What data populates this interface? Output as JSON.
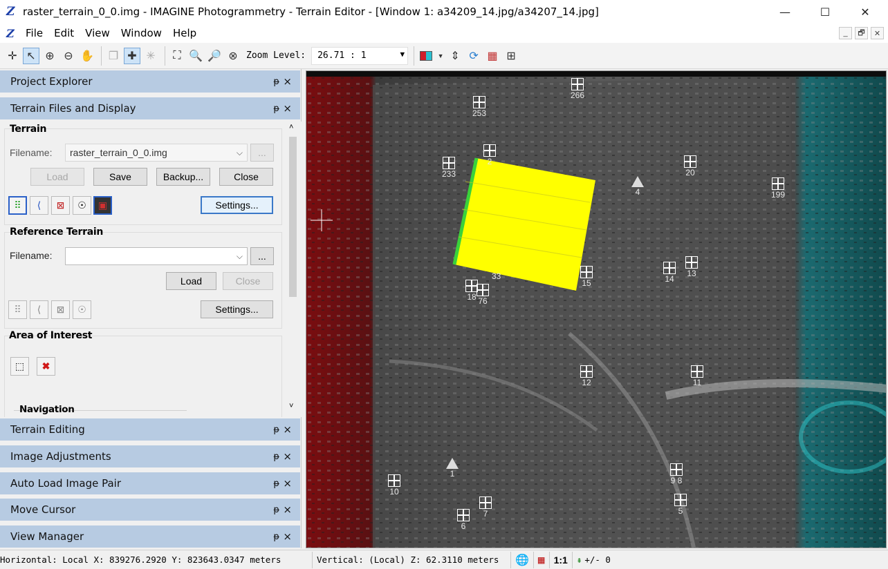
{
  "window": {
    "title": "raster_terrain_0_0.img - IMAGINE Photogrammetry - Terrain Editor - [Window 1: a34209_14.jpg/a34207_14.jpg]",
    "controls": [
      "—",
      "☐",
      "✕"
    ]
  },
  "menu": {
    "items": [
      "File",
      "Edit",
      "View",
      "Window",
      "Help"
    ],
    "mdi_controls": [
      "_",
      "🗗",
      "✕"
    ]
  },
  "toolbar": {
    "zoom_label": "Zoom Level:",
    "zoom_value": "26.71 : 1"
  },
  "panels": {
    "project_explorer": "Project Explorer",
    "terrain_files": "Terrain Files and Display",
    "terrain_editing": "Terrain Editing",
    "image_adjustments": "Image Adjustments",
    "auto_load": "Auto Load Image Pair",
    "move_cursor": "Move Cursor",
    "view_manager": "View Manager",
    "pin_glyph": "ᵽ",
    "close_glyph": "×"
  },
  "terrain": {
    "group_label": "Terrain",
    "filename_label": "Filename:",
    "filename_value": "raster_terrain_0_0.img",
    "browse": "...",
    "load": "Load",
    "save": "Save",
    "backup": "Backup...",
    "close": "Close",
    "settings": "Settings..."
  },
  "reference": {
    "group_label": "Reference Terrain",
    "filename_label": "Filename:",
    "filename_value": "",
    "browse": "...",
    "load": "Load",
    "close": "Close",
    "settings": "Settings..."
  },
  "aoi": {
    "group_label": "Area of Interest"
  },
  "navigation": {
    "label": "Navigation"
  },
  "gcps": [
    {
      "label": "266"
    },
    {
      "label": "253"
    },
    {
      "label": "233"
    },
    {
      "label": "2"
    },
    {
      "label": "20"
    },
    {
      "label": "4"
    },
    {
      "label": "199"
    },
    {
      "label": "15"
    },
    {
      "label": "14"
    },
    {
      "label": "13"
    },
    {
      "label": "33"
    },
    {
      "label": "18"
    },
    {
      "label": "76"
    },
    {
      "label": "12"
    },
    {
      "label": "11"
    },
    {
      "label": "1"
    },
    {
      "label": "10"
    },
    {
      "label": "7"
    },
    {
      "label": "6"
    },
    {
      "label": "9 8"
    },
    {
      "label": "5"
    }
  ],
  "status": {
    "horizontal": "Horizontal: Local X:  839276.2920  Y:  823643.0347 meters",
    "vertical": "Vertical: (Local) Z: 62.3110 meters",
    "scale": "1:1",
    "tolerance": "+/- 0"
  },
  "colors": {
    "panel_header": "#b7cbe2",
    "terrain_overlay": "#ffff00",
    "anaglyph_red": "#c8161b",
    "anaglyph_cyan": "#2ec4c8"
  }
}
